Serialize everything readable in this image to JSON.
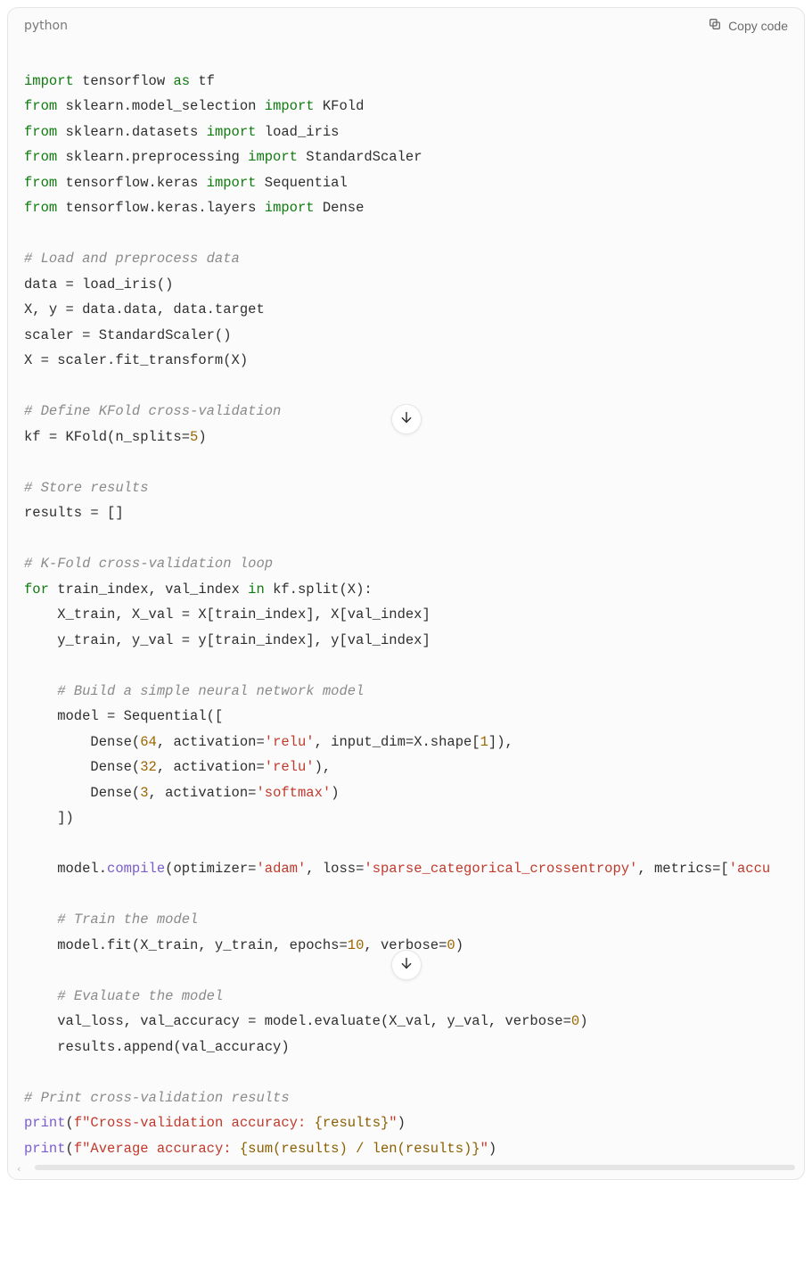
{
  "header": {
    "language": "python",
    "copy_label": "Copy code"
  },
  "icons": {
    "copy": "copy-icon",
    "down": "arrow-down-icon",
    "hscroll_left": "‹"
  },
  "code_lines": [
    "",
    "<span class='tok-kw'>import</span> tensorflow <span class='tok-kw'>as</span> tf",
    "<span class='tok-kw'>from</span> sklearn.model_selection <span class='tok-kw'>import</span> KFold",
    "<span class='tok-kw'>from</span> sklearn.datasets <span class='tok-kw'>import</span> load_iris",
    "<span class='tok-kw'>from</span> sklearn.preprocessing <span class='tok-kw'>import</span> StandardScaler",
    "<span class='tok-kw'>from</span> tensorflow.keras <span class='tok-kw'>import</span> Sequential",
    "<span class='tok-kw'>from</span> tensorflow.keras.layers <span class='tok-kw'>import</span> Dense",
    "",
    "<span class='tok-cmt'># Load and preprocess data</span>",
    "data = load_iris()",
    "X, y = data.data, data.target",
    "scaler = StandardScaler()",
    "X = scaler.fit_transform(X)",
    "",
    "<span class='tok-cmt'># Define KFold cross-validation</span>",
    "kf = KFold(n_splits=<span class='tok-num'>5</span>)",
    "",
    "<span class='tok-cmt'># Store results</span>",
    "results = []",
    "",
    "<span class='tok-cmt'># K-Fold cross-validation loop</span>",
    "<span class='tok-kw'>for</span> train_index, val_index <span class='tok-kw'>in</span> kf.split(X):",
    "    X_train, X_val = X[train_index], X[val_index]",
    "    y_train, y_val = y[train_index], y[val_index]",
    "",
    "    <span class='tok-cmt'># Build a simple neural network model</span>",
    "    model = Sequential([",
    "        Dense(<span class='tok-num'>64</span>, activation=<span class='tok-str'>'relu'</span>, input_dim=X.shape[<span class='tok-num'>1</span>]),",
    "        Dense(<span class='tok-num'>32</span>, activation=<span class='tok-str'>'relu'</span>),",
    "        Dense(<span class='tok-num'>3</span>, activation=<span class='tok-str'>'softmax'</span>)",
    "    ])",
    "",
    "    model.<span class='tok-fn'>compile</span>(optimizer=<span class='tok-str'>'adam'</span>, loss=<span class='tok-str'>'sparse_categorical_crossentropy'</span>, metrics=[<span class='tok-str'>'accu</span>",
    "",
    "    <span class='tok-cmt'># Train the model</span>",
    "    model.fit(X_train, y_train, epochs=<span class='tok-num'>10</span>, verbose=<span class='tok-num'>0</span>)",
    "",
    "    <span class='tok-cmt'># Evaluate the model</span>",
    "    val_loss, val_accuracy = model.evaluate(X_val, y_val, verbose=<span class='tok-num'>0</span>)",
    "    results.append(val_accuracy)",
    "",
    "<span class='tok-cmt'># Print cross-validation results</span>",
    "<span class='tok-fn'>print</span>(<span class='tok-str'>f&quot;Cross-validation accuracy: </span><span class='tok-brw'>{results}</span><span class='tok-str'>&quot;</span>)",
    "<span class='tok-fn'>print</span>(<span class='tok-str'>f&quot;Average accuracy: </span><span class='tok-brw'>{sum(results) / len(results)}</span><span class='tok-str'>&quot;</span>)",
    ""
  ]
}
